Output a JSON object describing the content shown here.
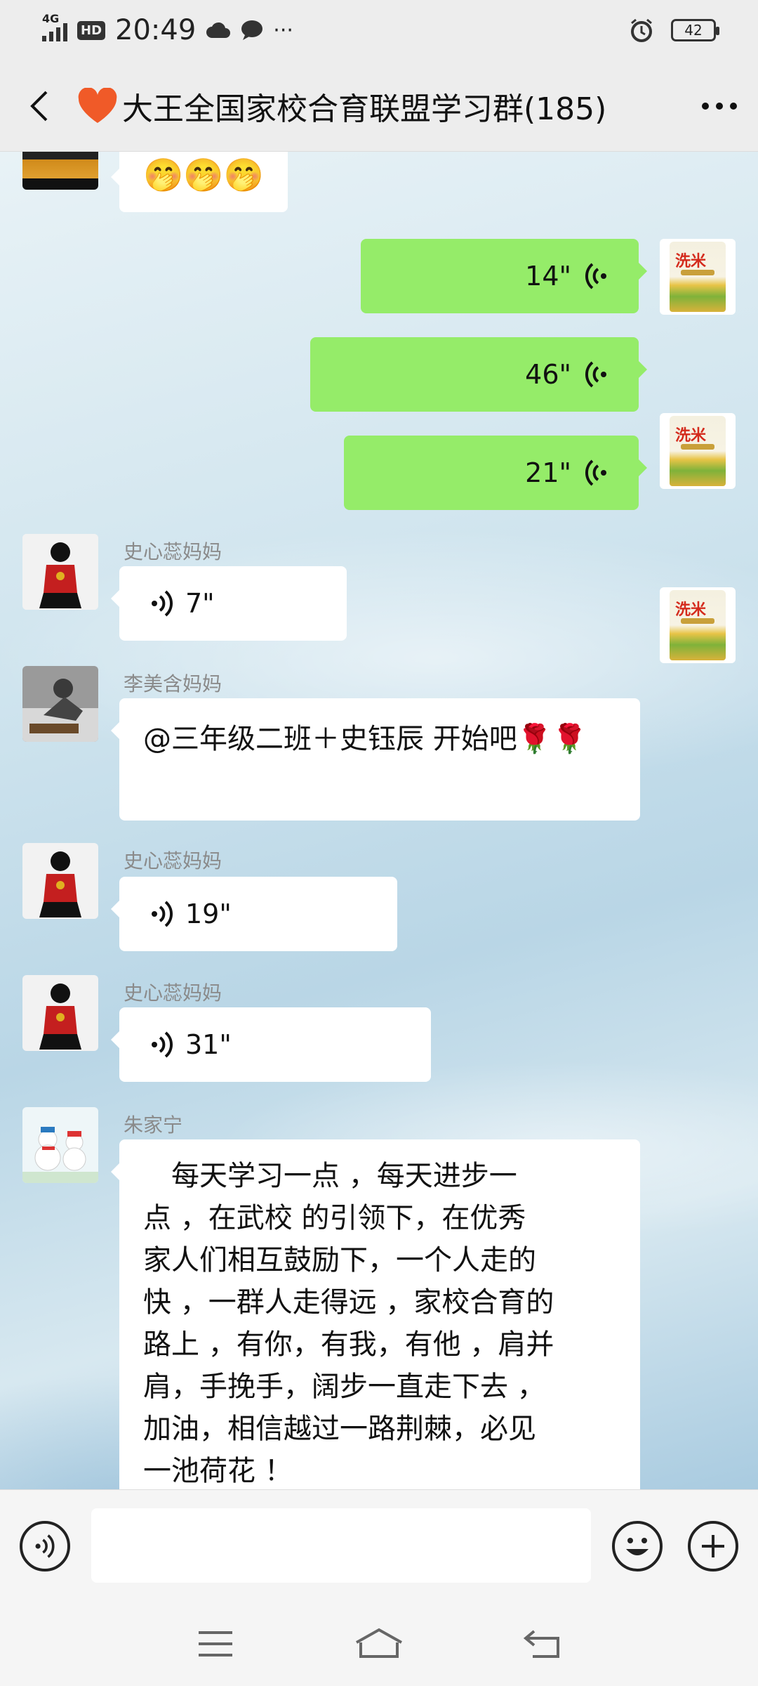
{
  "status_bar": {
    "network": "4G",
    "hd": "HD",
    "time": "20:49",
    "more": "···",
    "battery": "42"
  },
  "header": {
    "title": "大王全国家校合育联盟学习群(185)"
  },
  "messages": [
    {
      "type": "emoji",
      "side": "left",
      "text": "🤭🤭🤭"
    },
    {
      "type": "voice",
      "side": "right",
      "duration": "14\""
    },
    {
      "type": "voice",
      "side": "right",
      "duration": "46\""
    },
    {
      "type": "voice",
      "side": "right",
      "duration": "21\""
    },
    {
      "type": "voice",
      "side": "left",
      "sender": "史心蕊妈妈",
      "duration": "7\""
    },
    {
      "type": "text",
      "side": "left",
      "sender": "李美含妈妈",
      "text": "@三年级二班＋史钰辰  开始吧🌹🌹"
    },
    {
      "type": "voice",
      "side": "left",
      "sender": "史心蕊妈妈",
      "duration": "19\""
    },
    {
      "type": "voice",
      "side": "left",
      "sender": "史心蕊妈妈",
      "duration": "31\""
    },
    {
      "type": "text",
      "side": "left",
      "sender": "朱家宁",
      "lines": [
        "　每天学习一点 ，每天进步一",
        "点 ，在武校 的引领下，在优秀",
        "家人们相互鼓励下，一个人走的",
        "快 ，一群人走得远 ，家校合育的",
        "路上 ，有你，有我，有他 ，肩并",
        "肩，手挽手，阔步一直走下去 ，",
        "加油，相信越过一路荆棘，必见",
        "一池荷花 ！"
      ]
    }
  ],
  "rice_brand": "洗米",
  "input": {
    "placeholder": ""
  },
  "colors": {
    "sent_bubble": "#95ec69",
    "received_bubble": "#ffffff",
    "heart": "#f05a28"
  }
}
